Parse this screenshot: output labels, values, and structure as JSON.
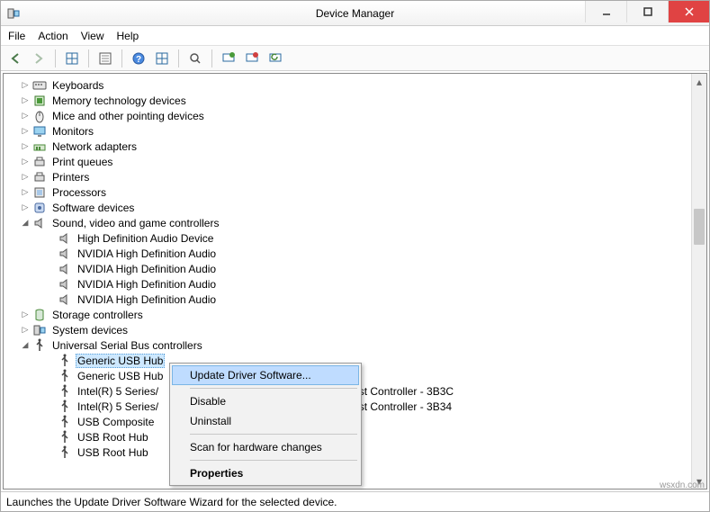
{
  "window": {
    "title": "Device Manager"
  },
  "menu": {
    "file": "File",
    "action": "Action",
    "view": "View",
    "help": "Help"
  },
  "tree": {
    "cat_keyboards": "Keyboards",
    "cat_memory": "Memory technology devices",
    "cat_mice": "Mice and other pointing devices",
    "cat_monitors": "Monitors",
    "cat_network": "Network adapters",
    "cat_printq": "Print queues",
    "cat_printers": "Printers",
    "cat_processors": "Processors",
    "cat_software": "Software devices",
    "cat_sound": "Sound, video and game controllers",
    "snd_0": "High Definition Audio Device",
    "snd_1": "NVIDIA High Definition Audio",
    "snd_2": "NVIDIA High Definition Audio",
    "snd_3": "NVIDIA High Definition Audio",
    "snd_4": "NVIDIA High Definition Audio",
    "cat_storage": "Storage controllers",
    "cat_system": "System devices",
    "cat_usb": "Universal Serial Bus controllers",
    "usb_0": "Generic USB Hub",
    "usb_1": "Generic USB Hub",
    "usb_2_p": "Intel(R) 5 Series/",
    "usb_2_s": "ost Controller - 3B3C",
    "usb_3_p": "Intel(R) 5 Series/",
    "usb_3_s": "ost Controller - 3B34",
    "usb_4": "USB Composite",
    "usb_5": "USB Root Hub",
    "usb_6": "USB Root Hub"
  },
  "context_menu": {
    "update": "Update Driver Software...",
    "disable": "Disable",
    "uninstall": "Uninstall",
    "scan": "Scan for hardware changes",
    "properties": "Properties"
  },
  "statusbar": "Launches the Update Driver Software Wizard for the selected device.",
  "watermark": "wsxdn.com"
}
